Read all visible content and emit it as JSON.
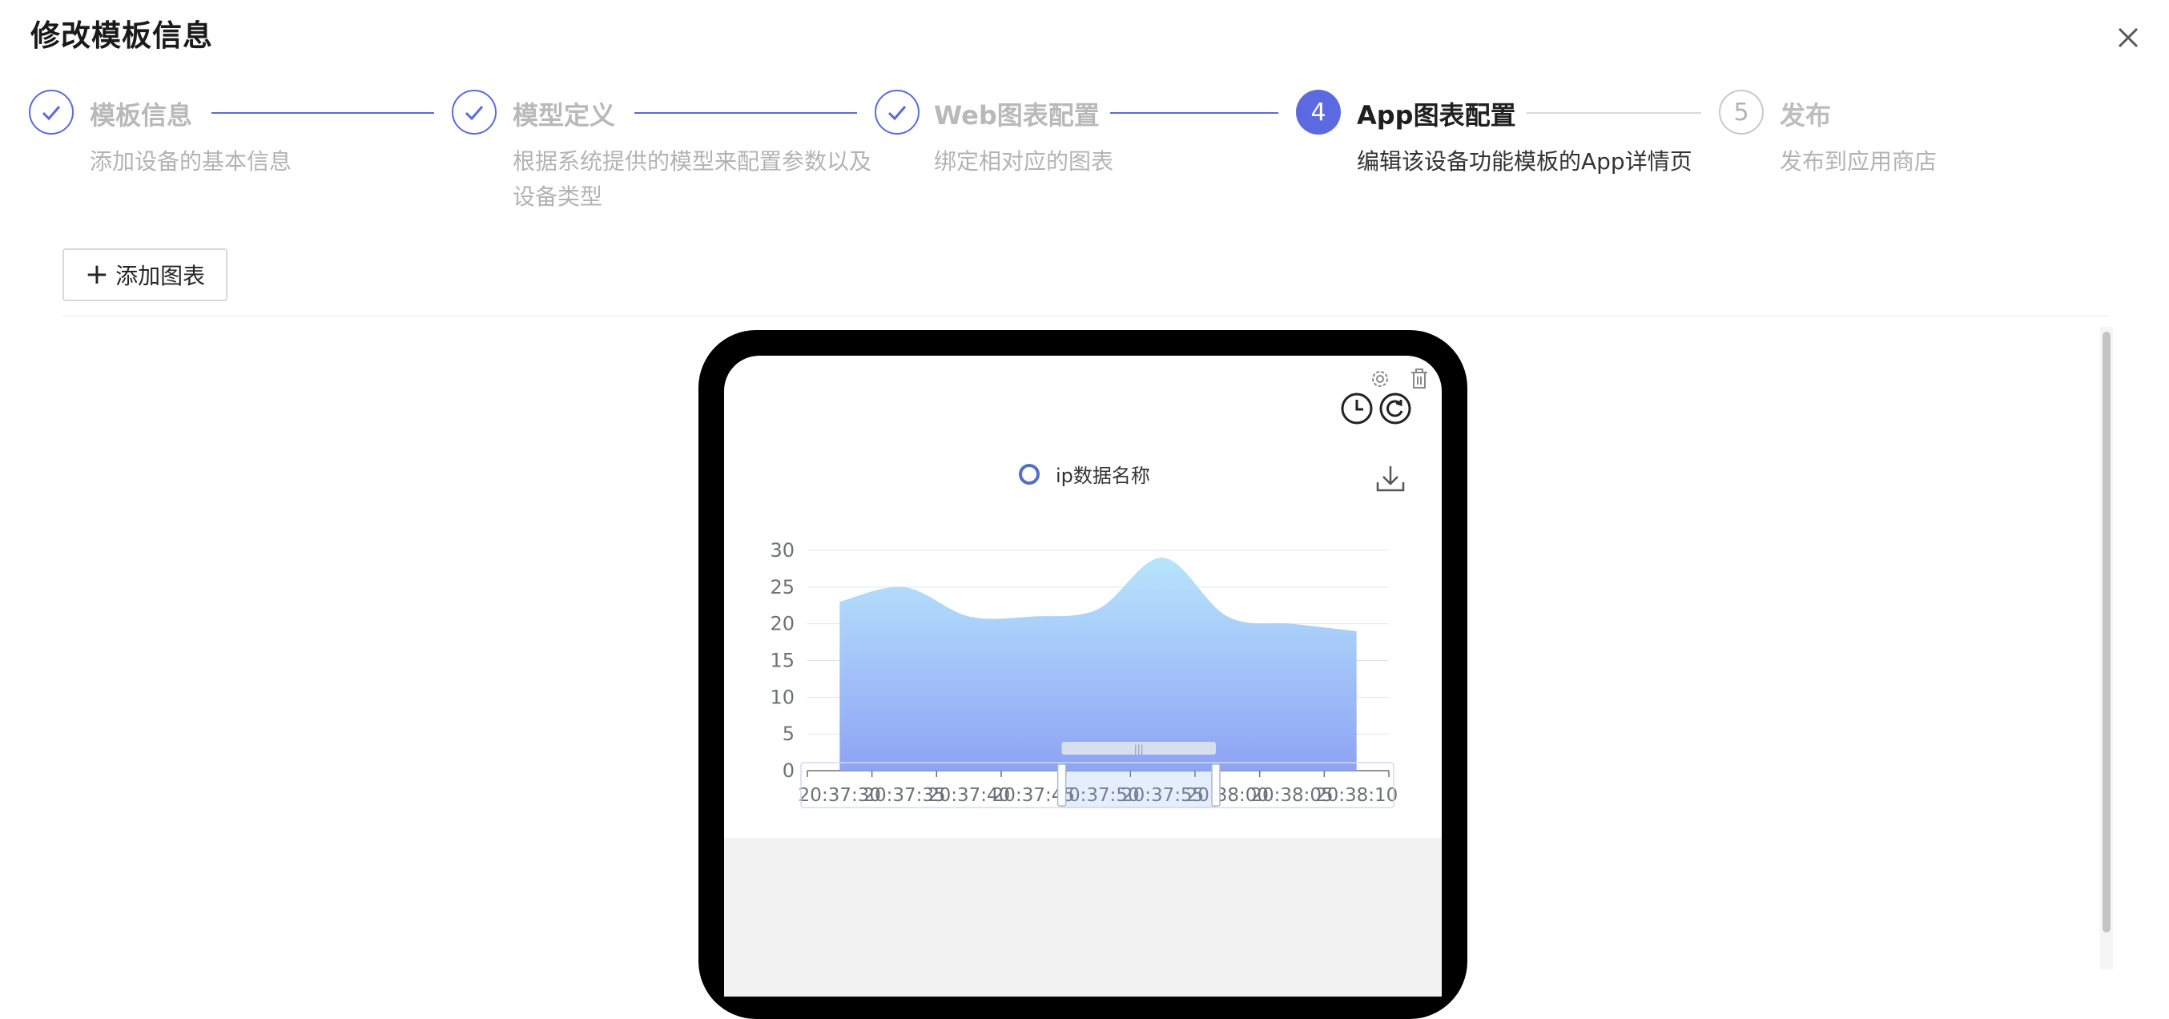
{
  "modal": {
    "title": "修改模板信息"
  },
  "steps": [
    {
      "number": "1",
      "title": "模板信息",
      "description": "添加设备的基本信息",
      "status": "done"
    },
    {
      "number": "2",
      "title": "模型定义",
      "description": "根据系统提供的模型来配置参数以及设备类型",
      "status": "done"
    },
    {
      "number": "3",
      "title": "Web图表配置",
      "description": "绑定相对应的图表",
      "status": "done"
    },
    {
      "number": "4",
      "title": "App图表配置",
      "description": "编辑该设备功能模板的App详情页",
      "status": "active"
    },
    {
      "number": "5",
      "title": "发布",
      "description": "发布到应用商店",
      "status": "wait"
    }
  ],
  "toolbar": {
    "add_chart_label": "添加图表"
  },
  "colors": {
    "accent": "#5b6ae0",
    "area_top": "#b8e5fb",
    "area_bottom": "#8ea3f5",
    "legend": "#5470c6"
  },
  "icons": [
    "close-icon",
    "check-icon",
    "gear-icon",
    "trash-icon",
    "clock-icon",
    "refresh-icon",
    "download-icon",
    "plus-icon"
  ],
  "chart_data": {
    "type": "area",
    "legend": [
      "ip数据名称"
    ],
    "x": [
      "20:37:30",
      "20:37:35",
      "20:37:40",
      "20:37:45",
      "20:37:50",
      "20:37:55",
      "20:38:00",
      "20:38:05",
      "20:38:10"
    ],
    "series": [
      {
        "name": "ip数据名称",
        "values": [
          23,
          25,
          21,
          21,
          22,
          29,
          21,
          20,
          19
        ]
      }
    ],
    "ylim": [
      0,
      30
    ],
    "yticks": [
      0,
      5,
      10,
      15,
      20,
      25,
      30
    ],
    "grid": true,
    "legend_position": "top",
    "data_zoom": {
      "start": 0.44,
      "end": 0.7
    }
  }
}
